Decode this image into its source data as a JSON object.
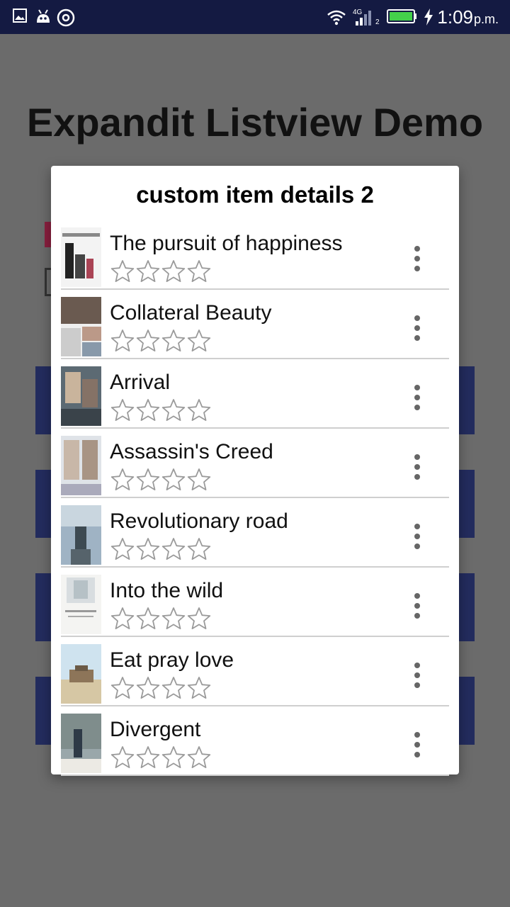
{
  "status_bar": {
    "time": "1:09",
    "ampm": "p.m.",
    "network": "4G",
    "sim": "2"
  },
  "app": {
    "title": "Expandit Listview Demo"
  },
  "dialog": {
    "title": "custom item details 2",
    "items": [
      {
        "title": "The pursuit of happiness",
        "rating": 0,
        "max_rating": 4
      },
      {
        "title": "Collateral Beauty",
        "rating": 0,
        "max_rating": 4
      },
      {
        "title": "Arrival",
        "rating": 0,
        "max_rating": 4
      },
      {
        "title": "Assassin's Creed",
        "rating": 0,
        "max_rating": 4
      },
      {
        "title": "Revolutionary road",
        "rating": 0,
        "max_rating": 4
      },
      {
        "title": "Into the wild",
        "rating": 0,
        "max_rating": 4
      },
      {
        "title": "Eat pray love",
        "rating": 0,
        "max_rating": 4
      },
      {
        "title": "Divergent",
        "rating": 0,
        "max_rating": 4
      }
    ]
  },
  "colors": {
    "status_bar": "#141a42",
    "scrim": "#6b6b6b",
    "bg_blocks": "#232c5e"
  }
}
